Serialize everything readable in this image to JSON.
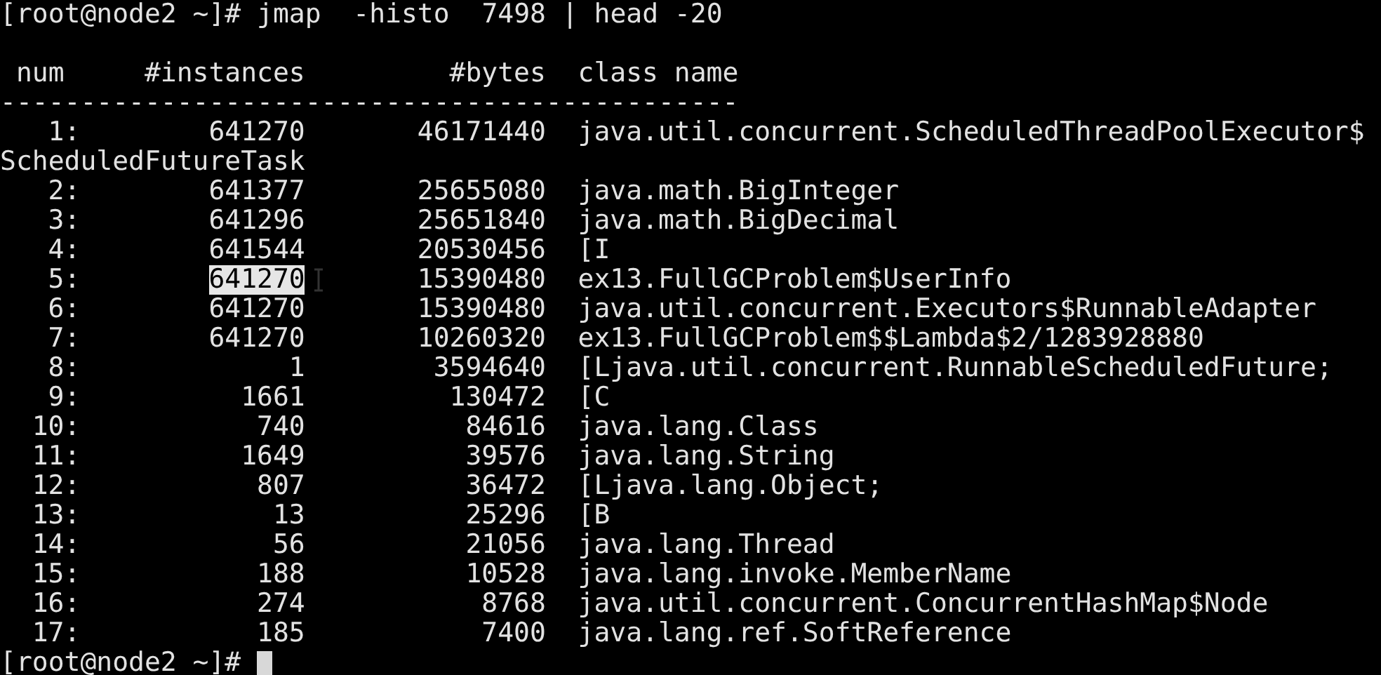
{
  "command_line": {
    "prompt": "[root@node2 ~]#",
    "command": "jmap  -histo  7498 | head -20"
  },
  "table": {
    "columns": [
      "num",
      "#instances",
      "#bytes",
      "class name"
    ],
    "separator": "----------------------------------------------",
    "rows": [
      {
        "num": "1:",
        "instances": "641270",
        "bytes": "46171440",
        "class_name": "java.util.concurrent.ScheduledThreadPoolExecutor$",
        "continuation": "ScheduledFutureTask",
        "selected": false
      },
      {
        "num": "2:",
        "instances": "641377",
        "bytes": "25655080",
        "class_name": "java.math.BigInteger",
        "selected": false
      },
      {
        "num": "3:",
        "instances": "641296",
        "bytes": "25651840",
        "class_name": "java.math.BigDecimal",
        "selected": false
      },
      {
        "num": "4:",
        "instances": "641544",
        "bytes": "20530456",
        "class_name": "[I",
        "selected": false
      },
      {
        "num": "5:",
        "instances": "641270",
        "bytes": "15390480",
        "class_name": "ex13.FullGCProblem$UserInfo",
        "selected": true
      },
      {
        "num": "6:",
        "instances": "641270",
        "bytes": "15390480",
        "class_name": "java.util.concurrent.Executors$RunnableAdapter",
        "selected": false
      },
      {
        "num": "7:",
        "instances": "641270",
        "bytes": "10260320",
        "class_name": "ex13.FullGCProblem$$Lambda$2/1283928880",
        "selected": false
      },
      {
        "num": "8:",
        "instances": "1",
        "bytes": "3594640",
        "class_name": "[Ljava.util.concurrent.RunnableScheduledFuture;",
        "selected": false
      },
      {
        "num": "9:",
        "instances": "1661",
        "bytes": "130472",
        "class_name": "[C",
        "selected": false
      },
      {
        "num": "10:",
        "instances": "740",
        "bytes": "84616",
        "class_name": "java.lang.Class",
        "selected": false
      },
      {
        "num": "11:",
        "instances": "1649",
        "bytes": "39576",
        "class_name": "java.lang.String",
        "selected": false
      },
      {
        "num": "12:",
        "instances": "807",
        "bytes": "36472",
        "class_name": "[Ljava.lang.Object;",
        "selected": false
      },
      {
        "num": "13:",
        "instances": "13",
        "bytes": "25296",
        "class_name": "[B",
        "selected": false
      },
      {
        "num": "14:",
        "instances": "56",
        "bytes": "21056",
        "class_name": "java.lang.Thread",
        "selected": false
      },
      {
        "num": "15:",
        "instances": "188",
        "bytes": "10528",
        "class_name": "java.lang.invoke.MemberName",
        "selected": false
      },
      {
        "num": "16:",
        "instances": "274",
        "bytes": "8768",
        "class_name": "java.util.concurrent.ConcurrentHashMap$Node",
        "selected": false
      },
      {
        "num": "17:",
        "instances": "185",
        "bytes": "7400",
        "class_name": "java.lang.ref.SoftReference",
        "selected": false
      }
    ]
  },
  "final_prompt": "[root@node2 ~]#"
}
